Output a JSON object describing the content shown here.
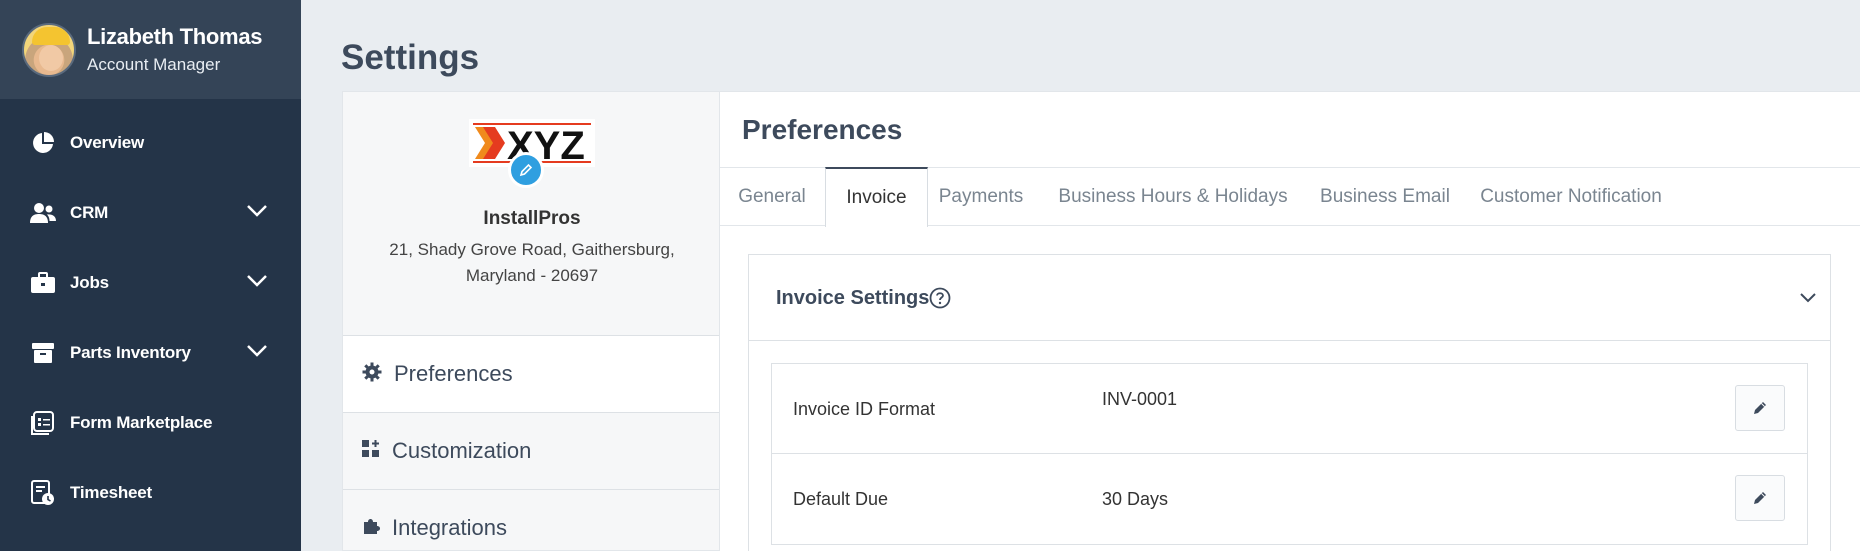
{
  "user": {
    "name": "Lizabeth Thomas",
    "role": "Account Manager"
  },
  "nav": [
    {
      "label": "Overview",
      "icon": "pie-chart-icon",
      "expandable": false
    },
    {
      "label": "CRM",
      "icon": "users-icon",
      "expandable": true
    },
    {
      "label": "Jobs",
      "icon": "briefcase-icon",
      "expandable": true
    },
    {
      "label": "Parts Inventory",
      "icon": "archive-box-icon",
      "expandable": true
    },
    {
      "label": "Form Marketplace",
      "icon": "form-icon",
      "expandable": false
    },
    {
      "label": "Timesheet",
      "icon": "timesheet-icon",
      "expandable": false
    }
  ],
  "page": {
    "title": "Settings"
  },
  "company": {
    "logo_text": "XYZ",
    "name": "InstallPros",
    "address_line1": "21, Shady Grove Road, Gaithersburg,",
    "address_line2": "Maryland - 20697"
  },
  "settings_menu": [
    {
      "label": "Preferences",
      "icon": "gear-icon",
      "active": true
    },
    {
      "label": "Customization",
      "icon": "widgets-icon",
      "active": false
    },
    {
      "label": "Integrations",
      "icon": "puzzle-icon",
      "active": false
    }
  ],
  "preferences": {
    "title": "Preferences",
    "tabs": [
      {
        "label": "General",
        "active": false
      },
      {
        "label": "Invoice",
        "active": true
      },
      {
        "label": "Payments",
        "active": false
      },
      {
        "label": "Business Hours & Holidays",
        "active": false
      },
      {
        "label": "Business Email",
        "active": false
      },
      {
        "label": "Customer Notification",
        "active": false
      }
    ]
  },
  "invoice_settings": {
    "title": "Invoice Settings",
    "rows": [
      {
        "label": "Invoice ID Format",
        "value": "INV-0001"
      },
      {
        "label": "Default Due",
        "value": "30 Days"
      }
    ]
  },
  "colors": {
    "sidebar": "#243448",
    "profile_bg": "#344457",
    "accent": "#3d4a5c",
    "logo_edit": "#2f9fe0"
  }
}
